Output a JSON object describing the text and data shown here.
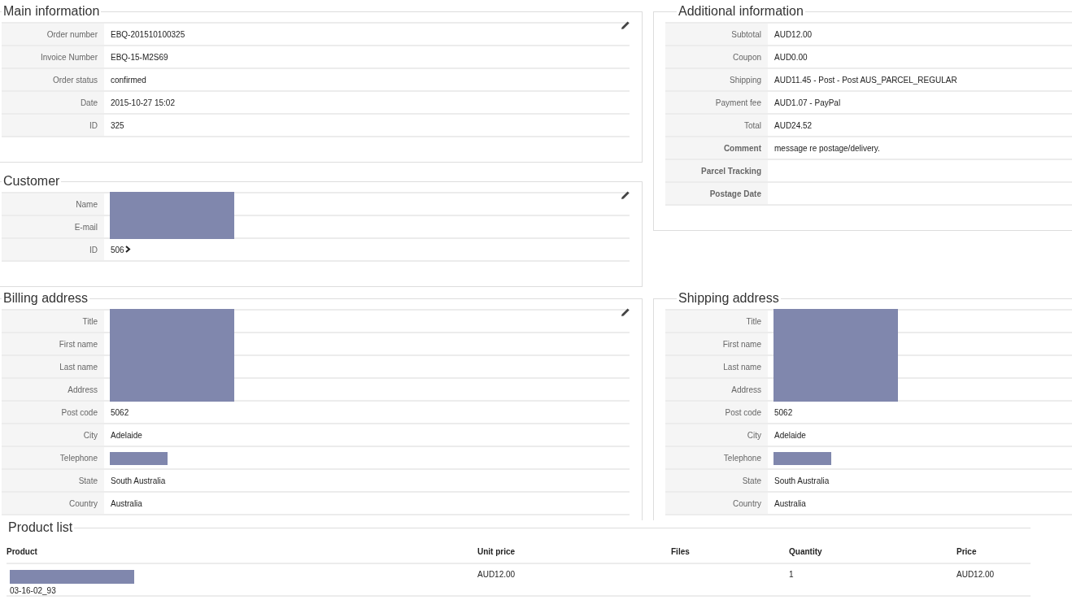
{
  "main_information": {
    "title": "Main information",
    "editable": true,
    "rows": [
      {
        "label": "Order number",
        "value": "EBQ-201510100325"
      },
      {
        "label": "Invoice Number",
        "value": "EBQ-15-M2S69"
      },
      {
        "label": "Order status",
        "value": "confirmed"
      },
      {
        "label": "Date",
        "value": "2015-10-27 15:02"
      },
      {
        "label": "ID",
        "value": "325"
      }
    ]
  },
  "additional_information": {
    "title": "Additional information",
    "editable": false,
    "rows": [
      {
        "label": "Subtotal",
        "value": "AUD12.00",
        "bold": false
      },
      {
        "label": "Coupon",
        "value": "AUD0.00",
        "bold": false
      },
      {
        "label": "Shipping",
        "value": "AUD11.45 - Post - Post AUS_PARCEL_REGULAR",
        "bold": false
      },
      {
        "label": "Payment fee",
        "value": "AUD1.07 - PayPal",
        "bold": false
      },
      {
        "label": "Total",
        "value": "AUD24.52",
        "bold": false
      },
      {
        "label": "Comment",
        "value": "message re postage/delivery.",
        "bold": true
      },
      {
        "label": "Parcel Tracking",
        "bold": true
      },
      {
        "label": "Postage Date",
        "bold": true
      }
    ]
  },
  "customer": {
    "title": "Customer",
    "editable": true,
    "rows": [
      {
        "label": "Name",
        "redacted": true
      },
      {
        "label": "E-mail",
        "redacted": true
      },
      {
        "label": "ID",
        "value": "506",
        "link": true
      }
    ]
  },
  "billing_address": {
    "title": "Billing address",
    "editable": true,
    "rows": [
      {
        "label": "Title",
        "redacted": true
      },
      {
        "label": "First name",
        "redacted": true
      },
      {
        "label": "Last name",
        "redacted": true
      },
      {
        "label": "Address",
        "redacted": true
      },
      {
        "label": "Post code",
        "value": "5062"
      },
      {
        "label": "City",
        "value": "Adelaide"
      },
      {
        "label": "Telephone",
        "redacted": true
      },
      {
        "label": "State",
        "value": "South Australia"
      },
      {
        "label": "Country",
        "value": "Australia"
      }
    ]
  },
  "shipping_address": {
    "title": "Shipping address",
    "editable": false,
    "rows": [
      {
        "label": "Title",
        "redacted": true
      },
      {
        "label": "First name",
        "redacted": true
      },
      {
        "label": "Last name",
        "redacted": true
      },
      {
        "label": "Address",
        "redacted": true
      },
      {
        "label": "Post code",
        "value": "5062"
      },
      {
        "label": "City",
        "value": "Adelaide"
      },
      {
        "label": "Telephone",
        "redacted": true
      },
      {
        "label": "State",
        "value": "South Australia"
      },
      {
        "label": "Country",
        "value": "Australia"
      }
    ]
  },
  "product_list": {
    "title": "Product list",
    "columns": [
      "Product",
      "Unit price",
      "Files",
      "Quantity",
      "Price"
    ],
    "rows": [
      {
        "product": "03-16-02_93",
        "product_redacted": true,
        "unit_price": "AUD12.00",
        "quantity": "1",
        "price": "AUD12.00"
      }
    ]
  }
}
